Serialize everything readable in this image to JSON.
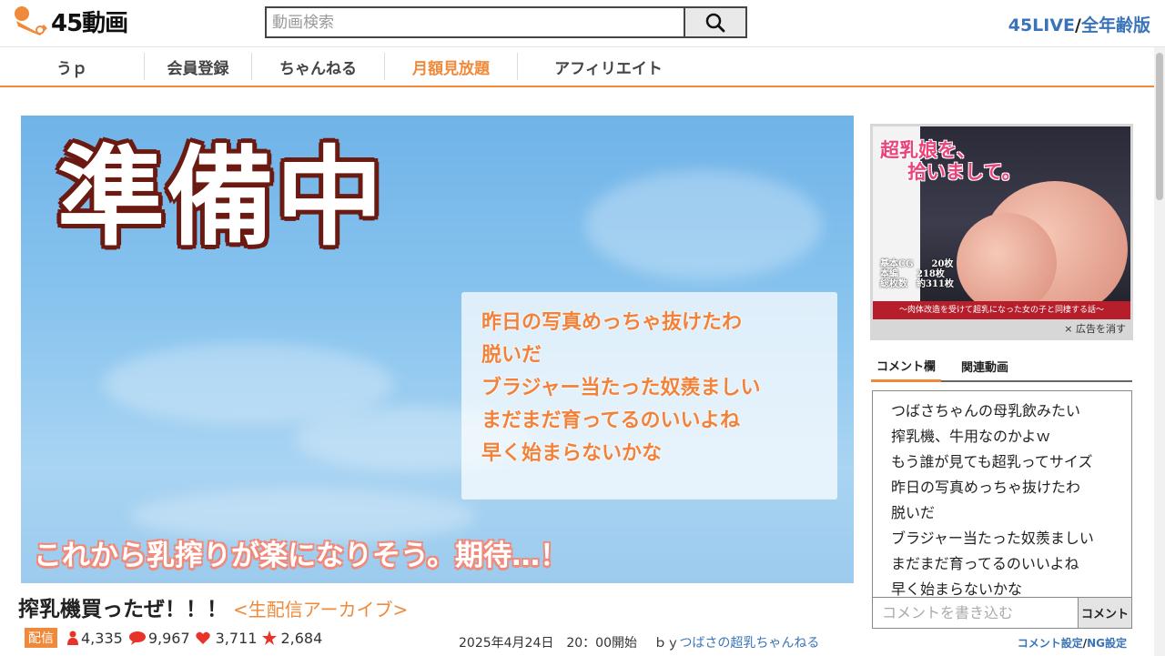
{
  "header": {
    "logo_text": "45動画",
    "search_placeholder": "動画検索",
    "right_link_1": "45LIVE",
    "right_sep": "/",
    "right_link_2": "全年齢版"
  },
  "nav": {
    "items": [
      "うｐ",
      "会員登録",
      "ちゃんねる",
      "月額見放題",
      "アフィリエイト"
    ]
  },
  "player": {
    "title_text": "準備中",
    "comments": [
      "昨日の写真めっちゃ抜けたわ",
      "脱いだ",
      "ブラジャー当たった奴羨ましい",
      "まだまだ育ってるのいいよね",
      "早く始まらないかな"
    ],
    "caption": "これから乳搾りが楽になりそう。期待…！"
  },
  "video": {
    "title": "搾乳機買ったぜ！！！",
    "archive_label": "<生配信アーカイブ>",
    "badge": "配信",
    "views": "4,335",
    "comments": "9,967",
    "likes": "3,711",
    "favorites": "2,684",
    "date": "2025年4月24日　20：00開始",
    "by_prefix": "ｂｙ",
    "channel": "つばさの超乳ちゃんねる"
  },
  "ad": {
    "title_line1": "超乳娘を、",
    "title_line2": "拾いまして。",
    "spec_1": "基本CG　　20枚",
    "spec_2": "本編　　218枚",
    "spec_3": "総枚数　約311枚",
    "banner": "〜肉体改造を受けて超乳になった女の子と同棲する話〜",
    "close_label": "× 広告を消す"
  },
  "sidebar": {
    "tab_comments": "コメント欄",
    "tab_related": "関連動画",
    "comment_items": [
      "つばさちゃんの母乳飲みたい",
      "搾乳機、牛用なのかよｗ",
      "もう誰が見ても超乳ってサイズ",
      "昨日の写真めっちゃ抜けたわ",
      "脱いだ",
      "ブラジャー当たった奴羨ましい",
      "まだまだ育ってるのいいよね",
      "早く始まらないかな"
    ],
    "comment_placeholder": "コメントを書き込む",
    "comment_submit": "コメント",
    "settings_1": "コメント設定",
    "settings_sep": "/",
    "settings_2": "NG設定"
  },
  "colors": {
    "accent": "#f08a3a",
    "link": "#3a74b8"
  }
}
